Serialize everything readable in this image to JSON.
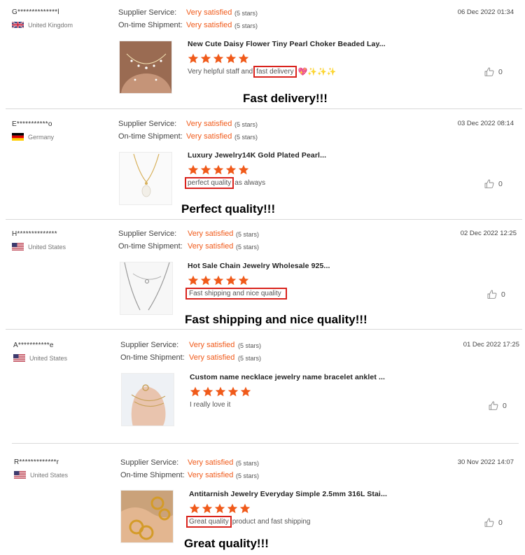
{
  "labels": {
    "supplier_service": "Supplier Service:",
    "ontime_shipment": "On-time Shipment:"
  },
  "colors": {
    "accent": "#f05a1a",
    "highlight_border": "#d9231d"
  },
  "reviews": [
    {
      "user": "G**************l",
      "country": "United Kingdom",
      "flag_icon": "uk-flag-icon",
      "supplier_service": "Very satisfied",
      "supplier_stars": "(5 stars)",
      "ontime_shipment": "Very satisfied",
      "ontime_stars": "(5 stars)",
      "date": "06 Dec 2022 01:34",
      "product_title": "New Cute Daisy Flower Tiny Pearl Choker Beaded Lay...",
      "rating": 5,
      "text_before": "Very helpful staff and ",
      "text_highlight": "fast delivery",
      "text_after": "",
      "text_emoji": "💖✨✨✨",
      "likes": "0",
      "caption": "Fast delivery!!!"
    },
    {
      "user": "E***********o",
      "country": "Germany",
      "flag_icon": "germany-flag-icon",
      "supplier_service": "Very satisfied",
      "supplier_stars": "(5 stars)",
      "ontime_shipment": "Very satisfied",
      "ontime_stars": "(5 stars)",
      "date": "03 Dec 2022 08:14",
      "product_title": "Luxury Jewelry14K Gold Plated Pearl...",
      "rating": 5,
      "text_before": "",
      "text_highlight": "perfect quality",
      "text_after": " as always",
      "text_emoji": "",
      "likes": "0",
      "caption": "Perfect quality!!!"
    },
    {
      "user": "H**************",
      "country": "United States",
      "flag_icon": "us-flag-icon",
      "supplier_service": "Very satisfied",
      "supplier_stars": "(5 stars)",
      "ontime_shipment": "Very satisfied",
      "ontime_stars": "(5 stars)",
      "date": "02 Dec 2022 12:25",
      "product_title": "Hot Sale Chain Jewelry Wholesale 925...",
      "rating": 5,
      "text_before": "",
      "text_highlight": "Fast shipping and nice quality",
      "text_after": "",
      "text_emoji": "",
      "likes": "0",
      "caption": "Fast shipping and nice quality!!!"
    },
    {
      "user": "A***********e",
      "country": "United States",
      "flag_icon": "us-flag-icon",
      "supplier_service": "Very satisfied",
      "supplier_stars": "(5 stars)",
      "ontime_shipment": "Very satisfied",
      "ontime_stars": "(5 stars)",
      "date": "01 Dec 2022 17:25",
      "product_title": "Custom name necklace jewelry name bracelet anklet ...",
      "rating": 5,
      "text_before": "I really love it",
      "text_highlight": "",
      "text_after": "",
      "text_emoji": "",
      "likes": "0",
      "caption": ""
    },
    {
      "user": "R*************r",
      "country": "United States",
      "flag_icon": "us-flag-icon",
      "supplier_service": "Very satisfied",
      "supplier_stars": "(5 stars)",
      "ontime_shipment": "Very satisfied",
      "ontime_stars": "(5 stars)",
      "date": "30 Nov 2022 14:07",
      "product_title": "Antitarnish Jewelry Everyday Simple 2.5mm 316L Stai...",
      "rating": 5,
      "text_before": "",
      "text_highlight": "Great quality",
      "text_after": " product and fast shipping",
      "text_emoji": "",
      "likes": "0",
      "caption": "Great quality!!!"
    }
  ]
}
